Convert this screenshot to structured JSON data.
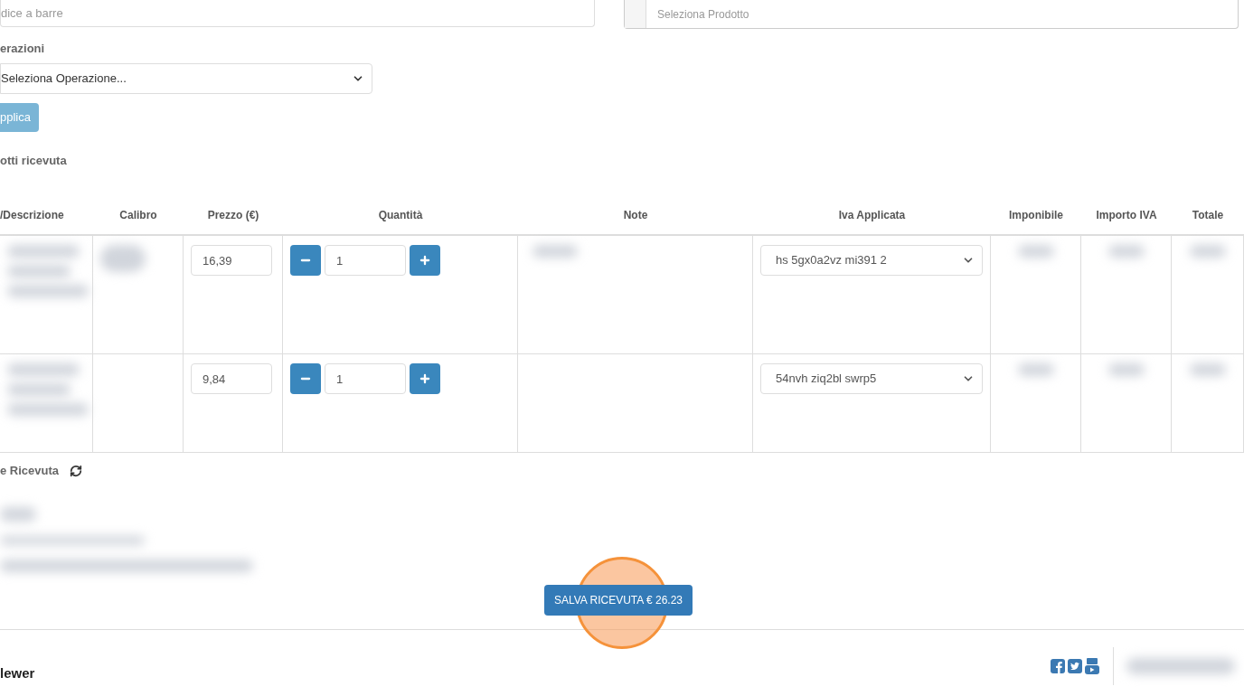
{
  "barcode_field": {
    "placeholder": "dice a barre"
  },
  "product_field": {
    "placeholder": "Seleziona Prodotto"
  },
  "operations": {
    "label": "erazioni",
    "select_value": "Seleziona Operazione...",
    "apply_button": "pplica"
  },
  "products_section": {
    "title": "otti ricevuta"
  },
  "table": {
    "columns": [
      "/Descrizione",
      "Calibro",
      "Prezzo (€)",
      "Quantità",
      "Note",
      "Iva Applicata",
      "Imponibile",
      "Importo IVA",
      "Totale"
    ],
    "rows": [
      {
        "price": "16,39",
        "quantity": "1",
        "vat": "hs 5gx0a2vz mi391 2",
        "redacted": [
          true,
          true,
          false,
          false,
          true,
          false,
          true,
          true,
          true
        ]
      },
      {
        "price": "9,84",
        "quantity": "1",
        "vat": "54nvh ziq2bl swrp5",
        "redacted": [
          true,
          false,
          false,
          false,
          false,
          false,
          true,
          true,
          true
        ]
      }
    ]
  },
  "summary": {
    "title": "e Ricevuta"
  },
  "save_button": "SALVA RICEVUTA € 26.23",
  "footer": {
    "brand": "lewer"
  }
}
